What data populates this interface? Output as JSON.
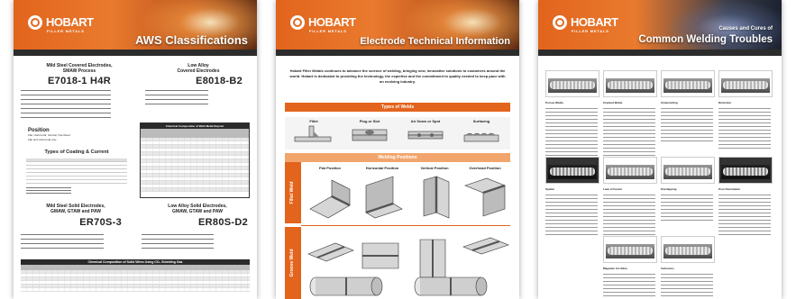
{
  "brand": {
    "name": "HOBART",
    "tagline": "FILLER METALS"
  },
  "posters": [
    {
      "title": "AWS Classifications",
      "sections": {
        "mild_steel_covered": {
          "heading": "Mild Steel Covered Electrodes,\nSMAW Process",
          "code": "E7018-1 H4R"
        },
        "low_alloy_covered": {
          "heading": "Low Alloy\nCovered Electrodes",
          "code": "E8018-B2"
        },
        "chem_table_title": "Chemical Composition of Weld Metal Deposit",
        "position": {
          "heading": "Position",
          "items": [
            "Flat, Horizontal, Vertical, Overhead",
            "Flat and Horizontal only"
          ]
        },
        "coating_current": {
          "heading": "Types of Coating & Current"
        },
        "mild_steel_solid": {
          "heading": "Mild Steel Solid Electrodes,\nGMAW, GTAW and PAW",
          "code": "ER70S-3"
        },
        "low_alloy_solid": {
          "heading": "Low Alloy Solid Electrodes,\nGMAW, GTAW and PAW",
          "code": "ER80S-D2"
        },
        "bottom_table_title": "Chemical Composition of Solid Wires Using CO₂ Shielding Gas"
      }
    },
    {
      "title": "Electrode Technical Information",
      "intro": "Hobart Filler Metals continues to advance the science of welding, bringing new, innovative solutions to customers around the world. Hobart is dedicated to providing the technology, the expertise and the commitment to quality needed to keep pace with an evolving industry.",
      "types_bar": "Types of Welds",
      "weld_types": [
        "Fillet",
        "Plug or Slot",
        "Air Seam or Spot",
        "Surfacing"
      ],
      "positions_bar": "Welding Positions",
      "position_columns": [
        "Flat Position",
        "Horizontal Position",
        "Vertical Position",
        "Overhead Position"
      ],
      "row_labels": [
        "Fillet Weld",
        "Groove Weld"
      ]
    },
    {
      "title": "Common Welding Troubles",
      "subtitle": "Causes and Cures of",
      "troubles": [
        "Porous Welds",
        "Cracked Welds",
        "Undercutting",
        "Distortion",
        "Spatter",
        "Lack of Fusion",
        "Overlapping",
        "Poor Penetration",
        "Magnetic Arc Blow",
        "Inclusions"
      ]
    }
  ]
}
